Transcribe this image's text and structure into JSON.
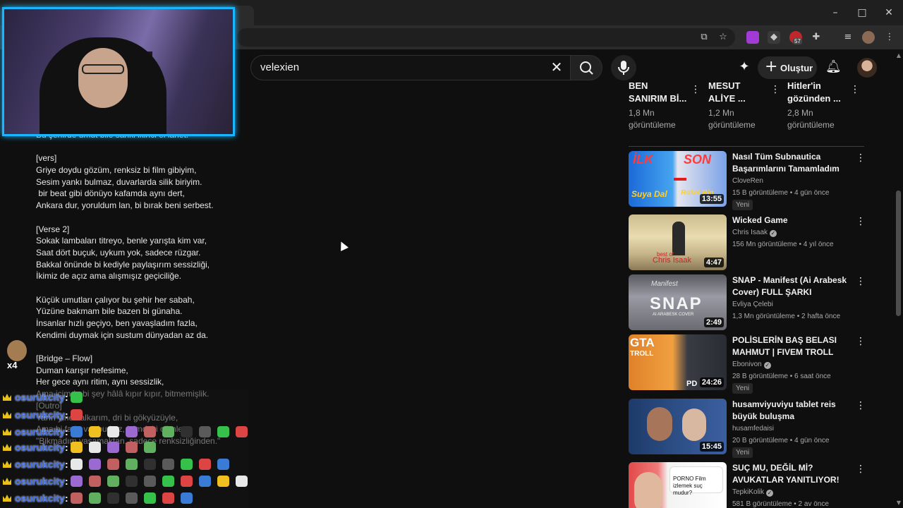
{
  "browser": {
    "window_controls": {
      "minimize": "–",
      "maximize": "□",
      "close": "✕"
    },
    "ext_badge": "57"
  },
  "youtube": {
    "search": {
      "query": "velexien"
    },
    "create_label": "Oluştur"
  },
  "description_lines": [
    "Bu şehirde umut bile sanki ikinci el lanet.",
    "",
    "[vers]",
    "Griye doydu gözüm, renksiz bi film gibiyim,",
    "Sesim yankı bulmaz, duvarlarda silik biriyim.",
    " bir beat gibi dönüyo kafamda aynı dert,",
    "Ankara dur, yoruldum lan, bi bırak beni serbest.",
    "",
    "[Verse 2]",
    "Sokak lambaları titreyo, benle yarışta kim var,",
    "Saat dört buçuk, uykum yok, sadece rüzgar.",
    "Bakkal önünde bi kediyle paylaşırım sessizliği,",
    "İkimiz de açız ama alışmışız geçiciliğe.",
    "",
    "Küçük umutları çalıyor bu şehir her sabah,",
    "Yüzüne bakmam bile bazen bi günaha.",
    "İnsanlar hızlı geçiyo, ben yavaşladım fazla,",
    "Kendimi duymak için sustum dünyadan az da.",
    "",
    "[Bridge – Flow]",
    "Duman karışır nefesime,",
    "Her gece aynı ritim, aynı sessizlik,",
    "Ama içimde bi şey hâlâ kıpır kıpır, bitmemişlik.",
    "[Outro]",
    "Yarın yine kalkarım, dri bi gökyüzüyle,",
    "Ama bi farkı var bu kez, içimdeki cümle:",
    "\"Bikmadım yaşamaktan, sadece renksizliğinden.\""
  ],
  "chat": {
    "username": "osurukcity",
    "colon": ":",
    "side_badge": "x4"
  },
  "shorts": [
    {
      "title": "BEN\nSANIRIM Bİ...",
      "views": "1,8 Mn\ngörüntüleme"
    },
    {
      "title": "MESUT\nALİYE ...",
      "views": "1,2 Mn\ngörüntüleme"
    },
    {
      "title": "Hitler'in\ngözünden ...",
      "views": "2,8 Mn\ngörüntüleme"
    }
  ],
  "videos": [
    {
      "title": "Nasıl Tüm Subnautica Başarımlarını Tamamladım ço...",
      "channel": "CloveRen",
      "meta": "15 B görüntüleme • 4 gün önce",
      "duration": "13:55",
      "badge": "Yeni",
      "verified": false,
      "thumb_texts": [
        "İLK",
        "SON",
        "Suya Dal",
        "Roket Bin"
      ]
    },
    {
      "title": "Wicked Game",
      "channel": "Chris Isaak",
      "meta": "156 Mn görüntüleme • 4 yıl önce",
      "duration": "4:47",
      "badge": "",
      "verified": true,
      "thumb_texts": [
        "best of",
        "Chris Isaak"
      ]
    },
    {
      "title": "SNAP - Manifest (Ai Arabesk Cover) FULL ŞARKI",
      "channel": "Evliya Çelebi",
      "meta": "1,3 Mn görüntüleme • 2 hafta önce",
      "duration": "2:49",
      "badge": "",
      "verified": false,
      "thumb_texts": [
        "Manifest",
        "SNAP",
        "AI ARABESK COVER"
      ]
    },
    {
      "title": "POLİSLERİN BAŞ BELASI MAHMUT | FIVEM TROLL",
      "channel": "Ebonivon",
      "meta": "28 B görüntüleme • 6 saat önce",
      "duration": "24:26",
      "badge": "Yeni",
      "verified": true,
      "thumb_texts": [
        "GTA",
        "TROLL",
        "PD"
      ]
    },
    {
      "title": "husamviyuviyu tablet reis büyük buluşma",
      "channel": "husamfedaisi",
      "meta": "20 B görüntüleme • 4 gün önce",
      "duration": "15:45",
      "badge": "Yeni",
      "verified": false,
      "thumb_texts": []
    },
    {
      "title": "SUÇ MU, DEĞİL Mİ? AVUKATLAR YANITLIYOR!",
      "channel": "TepkiKolik",
      "meta": "581 B görüntüleme • 2 av önce",
      "duration": "",
      "badge": "",
      "verified": true,
      "thumb_texts": [
        "PORNO Film izlemek suç mudur?"
      ]
    }
  ],
  "colors": {
    "accent_cam_border": "#19b6ff",
    "chat_username": "#3f6ee8",
    "background": "#0f0f0f"
  }
}
